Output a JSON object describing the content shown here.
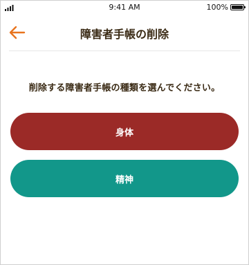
{
  "status_bar": {
    "time": "9:41 AM",
    "battery": "100%"
  },
  "header": {
    "title": "障害者手帳の削除",
    "back_icon": "back-arrow-icon"
  },
  "instruction": "削除する障害者手帳の種類を選んでください。",
  "options": [
    {
      "label": "身体",
      "color": "#9b2a27"
    },
    {
      "label": "精神",
      "color": "#12978a"
    }
  ],
  "colors": {
    "accent": "#e8741e",
    "title_text": "#3a2a14"
  }
}
